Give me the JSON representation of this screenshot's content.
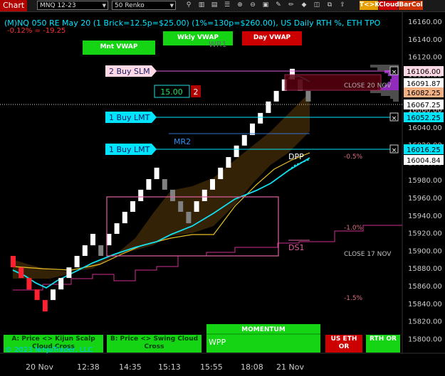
{
  "toolbar": {
    "title": "Chart",
    "instrument": "MNQ 12-23",
    "period": "50 Renko",
    "icons": [
      "search-icon",
      "bars-icon",
      "template-icon",
      "properties-icon",
      "zoom-in-icon",
      "zoom-out-icon",
      "strategy-icon",
      "drawing-tool-icon",
      "pencil-icon",
      "marker-icon",
      "workspace-icon",
      "tabs-icon",
      "share-icon"
    ],
    "buttons": [
      {
        "label": "T<>K",
        "color": "#e8a000"
      },
      {
        "label": "Cloud",
        "color": "#cc0000"
      },
      {
        "label": "BarCol",
        "color": "#cc3300"
      }
    ]
  },
  "header": {
    "line1": "(M)NQ 050 RE May 20 (1 Brick=12.5p=$25.00) (1%=130p=$260.00), US Daily RTH %, ETH TPO",
    "line2": "-0.12% = -19.25"
  },
  "top_buttons": [
    {
      "label": "Mnt VWAP"
    },
    {
      "label": "Wkly VWAP"
    },
    {
      "label": "Day VWAP"
    }
  ],
  "orders": [
    {
      "label": "2 Buy SLM",
      "price": "16106.00"
    },
    {
      "label": "1 Buy LMT",
      "price": "16052.25"
    },
    {
      "label": "1 Buy LMT",
      "price": "16016.25"
    }
  ],
  "position": {
    "value": "15.00",
    "qty": "2"
  },
  "levels": {
    "wr1": "WR1",
    "mr2": "MR2",
    "dpp": "DPP",
    "ds1": "DS1",
    "close20": "CLOSE 20 NOV",
    "close17": "CLOSE 17 NOV",
    "pct_neg05": "-0.5%",
    "pct_neg10": "-1.0%",
    "pct_neg15": "-1.5%"
  },
  "price_axis": {
    "ticks": [
      "16160.00",
      "16140.00",
      "16120.00",
      "16100.00",
      "16080.00",
      "16060.00",
      "16040.00",
      "16020.00",
      "16000.00",
      "15980.00",
      "15960.00",
      "15940.00",
      "15920.00",
      "15900.00",
      "15880.00",
      "15860.00",
      "15840.00",
      "15820.00",
      "15800.00"
    ],
    "labels": [
      {
        "text": "16106.00",
        "bg": "#ffd9e6"
      },
      {
        "text": "16091.87",
        "bg": "#ffffff"
      },
      {
        "text": "16082.25",
        "bg": "#f4b183"
      },
      {
        "text": "16067.25",
        "bg": "#ffffff"
      },
      {
        "text": "16052.25",
        "bg": "#00e5ff"
      },
      {
        "text": "16016.25",
        "bg": "#00e5ff"
      },
      {
        "text": "16004.84",
        "bg": "#ffffff"
      }
    ]
  },
  "time_axis": [
    "20 Nov",
    "12:38",
    "14:35",
    "15:13",
    "15:55",
    "18:08",
    "21 Nov"
  ],
  "bottom_buttons": [
    {
      "label": "A: Price <> Kijun Scalp Cloud Cross"
    },
    {
      "label": "B: Price <> Swing Cloud Cross"
    },
    {
      "label": "RTH OR"
    },
    {
      "label": "US ETH OR"
    }
  ],
  "momentum": {
    "title": "MOMENTUM",
    "value": "WPP"
  },
  "copyright": "© 2023 NinjaTrader, LLC",
  "chart_data": {
    "type": "renko",
    "brick_size": 12.5,
    "bricks": [
      {
        "open": 15895,
        "close": 15882,
        "dir": "down"
      },
      {
        "open": 15882,
        "close": 15870,
        "dir": "down"
      },
      {
        "open": 15870,
        "close": 15857,
        "dir": "down"
      },
      {
        "open": 15857,
        "close": 15845,
        "dir": "down"
      },
      {
        "open": 15845,
        "close": 15832,
        "dir": "down"
      },
      {
        "open": 15845,
        "close": 15857,
        "dir": "up"
      },
      {
        "open": 15857,
        "close": 15870,
        "dir": "up"
      },
      {
        "open": 15870,
        "close": 15882,
        "dir": "up"
      },
      {
        "open": 15882,
        "close": 15895,
        "dir": "up"
      },
      {
        "open": 15895,
        "close": 15907,
        "dir": "up"
      },
      {
        "open": 15907,
        "close": 15920,
        "dir": "up"
      },
      {
        "open": 15907,
        "close": 15895,
        "dir": "down"
      },
      {
        "open": 15907,
        "close": 15920,
        "dir": "up"
      },
      {
        "open": 15920,
        "close": 15932,
        "dir": "up"
      },
      {
        "open": 15932,
        "close": 15945,
        "dir": "up"
      },
      {
        "open": 15945,
        "close": 15957,
        "dir": "up"
      },
      {
        "open": 15957,
        "close": 15970,
        "dir": "up"
      },
      {
        "open": 15970,
        "close": 15982,
        "dir": "up"
      },
      {
        "open": 15982,
        "close": 15995,
        "dir": "up"
      },
      {
        "open": 15982,
        "close": 15970,
        "dir": "down"
      },
      {
        "open": 15970,
        "close": 15957,
        "dir": "down"
      },
      {
        "open": 15957,
        "close": 15945,
        "dir": "down"
      },
      {
        "open": 15945,
        "close": 15932,
        "dir": "down"
      },
      {
        "open": 15945,
        "close": 15957,
        "dir": "up"
      },
      {
        "open": 15957,
        "close": 15970,
        "dir": "up"
      },
      {
        "open": 15970,
        "close": 15982,
        "dir": "up"
      },
      {
        "open": 15982,
        "close": 15995,
        "dir": "up"
      },
      {
        "open": 15995,
        "close": 16007,
        "dir": "up"
      },
      {
        "open": 16007,
        "close": 16020,
        "dir": "up"
      },
      {
        "open": 16020,
        "close": 16032,
        "dir": "up"
      },
      {
        "open": 16032,
        "close": 16045,
        "dir": "up"
      },
      {
        "open": 16045,
        "close": 16057,
        "dir": "up"
      },
      {
        "open": 16057,
        "close": 16070,
        "dir": "up"
      },
      {
        "open": 16070,
        "close": 16082,
        "dir": "up"
      },
      {
        "open": 16082,
        "close": 16095,
        "dir": "up"
      },
      {
        "open": 16095,
        "close": 16107,
        "dir": "up"
      },
      {
        "open": 16095,
        "close": 16082,
        "dir": "down"
      },
      {
        "open": 16082,
        "close": 16070,
        "dir": "down"
      }
    ]
  }
}
